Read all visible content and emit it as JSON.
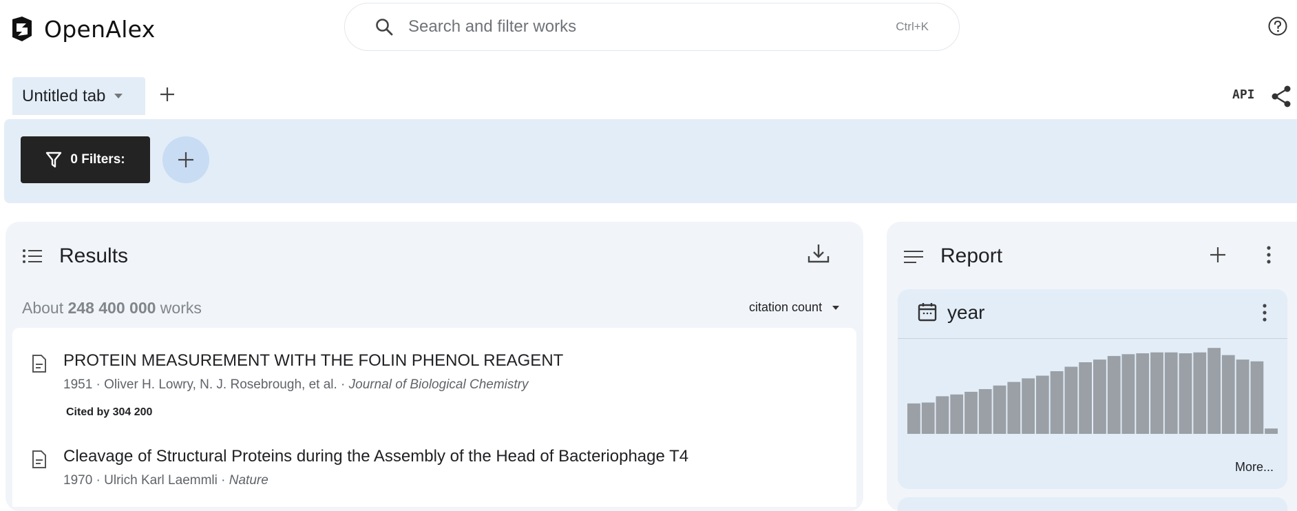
{
  "header": {
    "app_name": "OpenAlex",
    "search_placeholder": "Search and filter works",
    "search_shortcut": "Ctrl+K",
    "help_icon": "help-circle-icon"
  },
  "tabs": {
    "active_label": "Untitled tab",
    "api_label": "API",
    "share_icon": "share-icon"
  },
  "filters": {
    "button_label": "0 Filters:",
    "add_icon": "plus-icon"
  },
  "results": {
    "title": "Results",
    "count_prefix": "About",
    "count_value": "248 400 000",
    "count_suffix": "works",
    "sort_label": "citation count",
    "items": [
      {
        "title": "PROTEIN MEASUREMENT WITH THE FOLIN PHENOL REAGENT",
        "meta": "1951 · Oliver H. Lowry, N. J. Rosebrough, et al. · ",
        "venue": "Journal of Biological Chemistry",
        "cited": "Cited by 304 200"
      },
      {
        "title": "Cleavage of Structural Proteins during the Assembly of the Head of Bacteriophage T4",
        "meta": "1970 · Ulrich Karl Laemmli · ",
        "venue": "Nature",
        "cited": ""
      }
    ]
  },
  "report": {
    "title": "Report",
    "card_title": "year",
    "more_label": "More...",
    "colors": {
      "bar": "#9aa0a6",
      "panel": "#f1f4f8",
      "card": "#e3edf7"
    }
  },
  "chart_data": {
    "type": "bar",
    "title": "year",
    "values": [
      0.34,
      0.35,
      0.42,
      0.44,
      0.47,
      0.5,
      0.54,
      0.58,
      0.62,
      0.65,
      0.7,
      0.75,
      0.8,
      0.83,
      0.87,
      0.89,
      0.9,
      0.91,
      0.91,
      0.9,
      0.91,
      0.96,
      0.88,
      0.83,
      0.81,
      0.06
    ],
    "ylim": [
      0,
      1
    ],
    "grid": false
  }
}
